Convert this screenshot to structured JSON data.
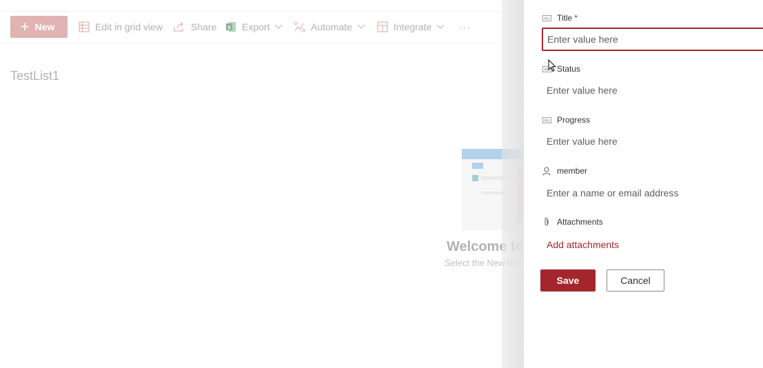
{
  "commandbar": {
    "new_label": "New",
    "edit_grid_label": "Edit in grid view",
    "share_label": "Share",
    "export_label": "Export",
    "automate_label": "Automate",
    "integrate_label": "Integrate",
    "more_label": "···"
  },
  "list": {
    "title": "TestList1",
    "welcome_title": "Welcome to",
    "welcome_subtitle": "Select the New bu"
  },
  "form": {
    "fields": [
      {
        "label": "Title",
        "required_mark": "*",
        "placeholder": "Enter value here",
        "icon": "text-field-icon"
      },
      {
        "label": "Status",
        "placeholder": "Enter value here",
        "icon": "text-field-icon"
      },
      {
        "label": "Progress",
        "placeholder": "Enter value here",
        "icon": "text-field-icon"
      },
      {
        "label": "member",
        "placeholder": "Enter a name or email address",
        "icon": "person-icon"
      },
      {
        "label": "Attachments",
        "link": "Add attachments",
        "icon": "paperclip-icon"
      }
    ],
    "save_label": "Save",
    "cancel_label": "Cancel"
  },
  "colors": {
    "accent": "#a4262c",
    "new_button": "#d28b8b",
    "export_icon": "#4f8a5b"
  }
}
